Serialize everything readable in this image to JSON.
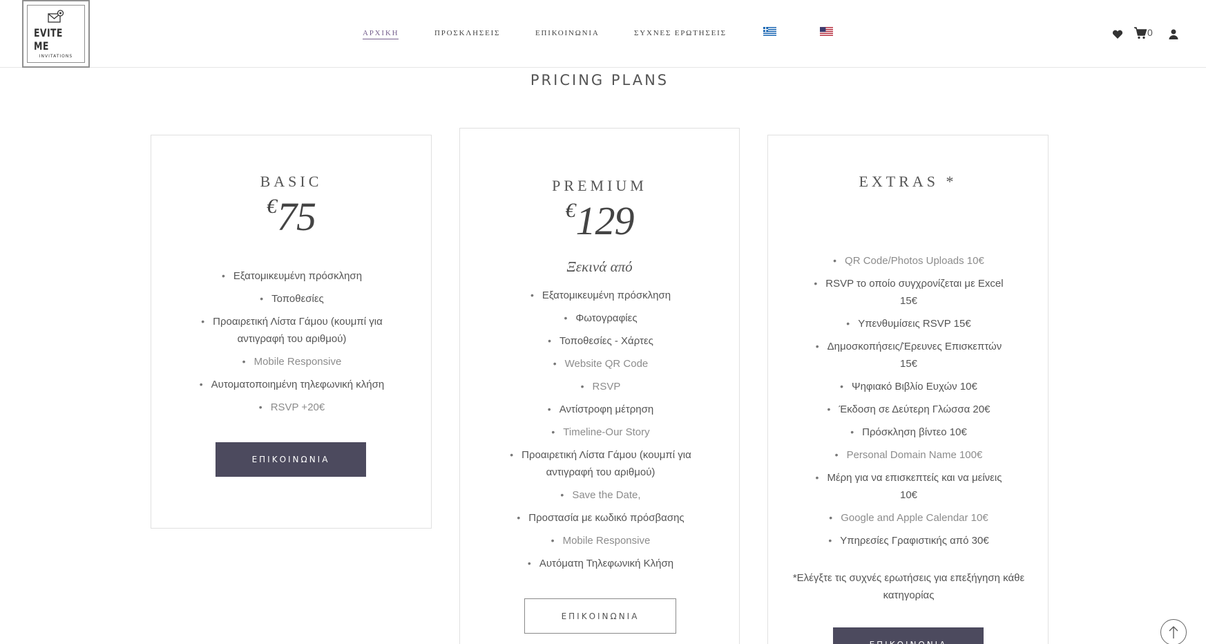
{
  "logo": {
    "title": "EVITE ME",
    "subtitle": "INVITATIONS",
    "icon": "envelope-icon"
  },
  "nav": {
    "items": [
      {
        "label": "ΑΡΧΙΚΗ",
        "active": true
      },
      {
        "label": "ΠΡΟΣΚΛΗΣΕΙΣ",
        "active": false
      },
      {
        "label": "ΕΠΙΚΟΙΝΩΝΙΑ",
        "active": false
      },
      {
        "label": "ΣΥΧΝΕΣ ΕΡΩΤΗΣΕΙΣ",
        "active": false
      }
    ],
    "flags": [
      "greek-flag-icon",
      "us-flag-icon"
    ]
  },
  "header_icons": {
    "wishlist": "heart-icon",
    "cart": "cart-icon",
    "cart_count": "0",
    "account": "user-icon"
  },
  "section_title": "PRICING PLANS",
  "plans": {
    "basic": {
      "name": "BASIC",
      "currency": "€",
      "price": "75",
      "features": [
        {
          "text": "Εξατομικευμένη πρόσκληση"
        },
        {
          "text": "Τοποθεσίες"
        },
        {
          "text": "Προαιρετική Λίστα Γάμου (κουμπί για αντιγραφή του αριθμού)"
        },
        {
          "text": "Mobile Responsive"
        },
        {
          "text": "Αυτοματοποιημένη τηλεφωνική κλήση"
        },
        {
          "text": "RSVP +20€"
        }
      ],
      "button": "ΕΠΙΚΟΙΝΩΝΙΑ"
    },
    "premium": {
      "name": "PREMIUM",
      "currency": "€",
      "price": "129",
      "from_label": "Ξεκινά από",
      "features": [
        {
          "text": "Εξατομικευμένη πρόσκληση"
        },
        {
          "text": "Φωτογραφίες"
        },
        {
          "text": "Τοποθεσίες - Χάρτες"
        },
        {
          "text": "Website QR Code"
        },
        {
          "text": "RSVP"
        },
        {
          "text": "Αντίστροφη μέτρηση"
        },
        {
          "text": "Timeline-Our Story"
        },
        {
          "text": "Προαιρετική Λίστα Γάμου (κουμπί για αντιγραφή του αριθμού)"
        },
        {
          "text": "Save the Date,"
        },
        {
          "text": "Προστασία με κωδικό πρόσβασης"
        },
        {
          "text": "Mobile Responsive"
        },
        {
          "text": "Αυτόματη Τηλεφωνική Κλήση"
        }
      ],
      "button": "ΕΠΙΚΟΙΝΩΝΙΑ"
    },
    "extras": {
      "name": "EXTRAS *",
      "features": [
        {
          "text": "QR Code/Photos Uploads 10€"
        },
        {
          "text": "RSVP το οποίο συγχρονίζεται με Excel 15€"
        },
        {
          "text": "Υπενθυμίσεις RSVP 15€"
        },
        {
          "text": "Δημοσκοπήσεις/Έρευνες Επισκεπτών 15€"
        },
        {
          "text": "Ψηφιακό Βιβλίο Ευχών 10€"
        },
        {
          "text": "Έκδοση σε Δεύτερη Γλώσσα 20€"
        },
        {
          "text": "Πρόσκληση βίντεο 10€"
        },
        {
          "text": "Personal Domain Name 100€"
        },
        {
          "text": "Μέρη για να επισκεπτείς και να μείνεις 10€"
        },
        {
          "text": "Google and Apple Calendar 10€"
        },
        {
          "text": "Υπηρεσίες Γραφιστικής από 30€"
        }
      ],
      "note": "*Ελέγξτε τις συχνές ερωτήσεις για επεξήγηση κάθε κατηγορίας",
      "button": "ΕΠΙΚΟΙΝΩΝΙΑ"
    }
  },
  "scroll_top_icon": "arrow-up-icon",
  "colors": {
    "accent": "#76608e",
    "button_dark": "#4c4a5e",
    "text": "#555555",
    "text_light": "#8c8c8c"
  }
}
